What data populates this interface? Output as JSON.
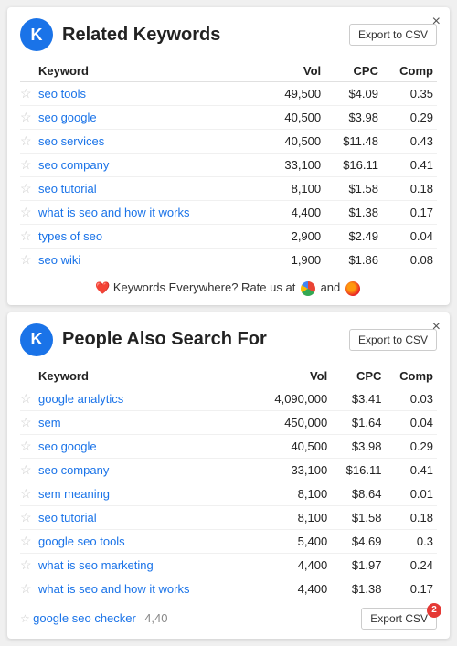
{
  "panel1": {
    "title": "Related Keywords",
    "logo": "K",
    "export_label": "Export to CSV",
    "close": "×",
    "columns": [
      "Keyword",
      "Vol",
      "CPC",
      "Comp"
    ],
    "rows": [
      {
        "star": "☆",
        "keyword": "seo tools",
        "vol": "49,500",
        "cpc": "$4.09",
        "comp": "0.35"
      },
      {
        "star": "☆",
        "keyword": "seo google",
        "vol": "40,500",
        "cpc": "$3.98",
        "comp": "0.29"
      },
      {
        "star": "☆",
        "keyword": "seo services",
        "vol": "40,500",
        "cpc": "$11.48",
        "comp": "0.43"
      },
      {
        "star": "☆",
        "keyword": "seo company",
        "vol": "33,100",
        "cpc": "$16.11",
        "comp": "0.41"
      },
      {
        "star": "☆",
        "keyword": "seo tutorial",
        "vol": "8,100",
        "cpc": "$1.58",
        "comp": "0.18"
      },
      {
        "star": "☆",
        "keyword": "what is seo and how it works",
        "vol": "4,400",
        "cpc": "$1.38",
        "comp": "0.17"
      },
      {
        "star": "☆",
        "keyword": "types of seo",
        "vol": "2,900",
        "cpc": "$2.49",
        "comp": "0.04"
      },
      {
        "star": "☆",
        "keyword": "seo wiki",
        "vol": "1,900",
        "cpc": "$1.86",
        "comp": "0.08"
      }
    ],
    "rate_text": "Keywords Everywhere? Rate us at",
    "rate_and": "and"
  },
  "panel2": {
    "title": "People Also Search For",
    "logo": "K",
    "export_label": "Export to CSV",
    "export_badge": "2",
    "close": "×",
    "columns": [
      "Keyword",
      "Vol",
      "CPC",
      "Comp"
    ],
    "rows": [
      {
        "star": "☆",
        "keyword": "google analytics",
        "vol": "4,090,000",
        "cpc": "$3.41",
        "comp": "0.03"
      },
      {
        "star": "☆",
        "keyword": "sem",
        "vol": "450,000",
        "cpc": "$1.64",
        "comp": "0.04"
      },
      {
        "star": "☆",
        "keyword": "seo google",
        "vol": "40,500",
        "cpc": "$3.98",
        "comp": "0.29"
      },
      {
        "star": "☆",
        "keyword": "seo company",
        "vol": "33,100",
        "cpc": "$16.11",
        "comp": "0.41"
      },
      {
        "star": "☆",
        "keyword": "sem meaning",
        "vol": "8,100",
        "cpc": "$8.64",
        "comp": "0.01"
      },
      {
        "star": "☆",
        "keyword": "seo tutorial",
        "vol": "8,100",
        "cpc": "$1.58",
        "comp": "0.18"
      },
      {
        "star": "☆",
        "keyword": "google seo tools",
        "vol": "5,400",
        "cpc": "$4.69",
        "comp": "0.3"
      },
      {
        "star": "☆",
        "keyword": "what is seo marketing",
        "vol": "4,400",
        "cpc": "$1.97",
        "comp": "0.24"
      },
      {
        "star": "☆",
        "keyword": "what is seo and how it works",
        "vol": "4,400",
        "cpc": "$1.38",
        "comp": "0.17"
      },
      {
        "star": "☆",
        "keyword": "google seo checker",
        "vol": "4,40",
        "cpc": "",
        "comp": ""
      }
    ],
    "bottom_partial": "Export CSV"
  }
}
